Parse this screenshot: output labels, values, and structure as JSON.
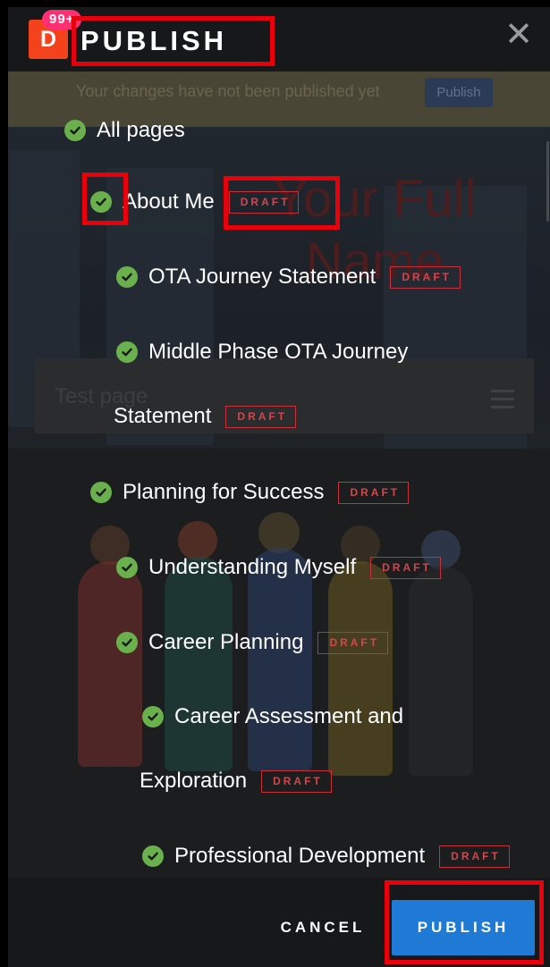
{
  "header": {
    "logo_letter": "D",
    "notification_count": "99+",
    "title": "PUBLISH",
    "close_icon": "close-icon",
    "close_glyph": "✕"
  },
  "background": {
    "banner_text": "Your changes have not been published yet",
    "banner_button": "Publish",
    "hero_title": "Your Full Name",
    "test_page_label": "Test page"
  },
  "tree": {
    "items": [
      {
        "label": "All pages",
        "draft": false
      },
      {
        "label": "About Me",
        "draft": true
      },
      {
        "label": "OTA Journey Statement",
        "draft": true
      },
      {
        "label_line1": "Middle Phase OTA Journey",
        "label_line2": "Statement",
        "draft": true
      },
      {
        "label": "Planning for Success",
        "draft": true
      },
      {
        "label": "Understanding Myself",
        "draft": true
      },
      {
        "label": "Career Planning",
        "draft": true
      },
      {
        "label_line1": "Career Assessment and",
        "label_line2": "Exploration",
        "draft": true
      },
      {
        "label": "Professional Development",
        "draft": true
      }
    ],
    "draft_label": "DRAFT",
    "check_icon": "check-circle-icon"
  },
  "footer": {
    "cancel_label": "CANCEL",
    "publish_label": "PUBLISH"
  },
  "colors": {
    "accent": "#1f7ad6",
    "check": "#6ab04c",
    "draft": "#c8313a",
    "logo": "#f4421c",
    "badge": "#ff2f74",
    "highlight": "#e8000b"
  }
}
